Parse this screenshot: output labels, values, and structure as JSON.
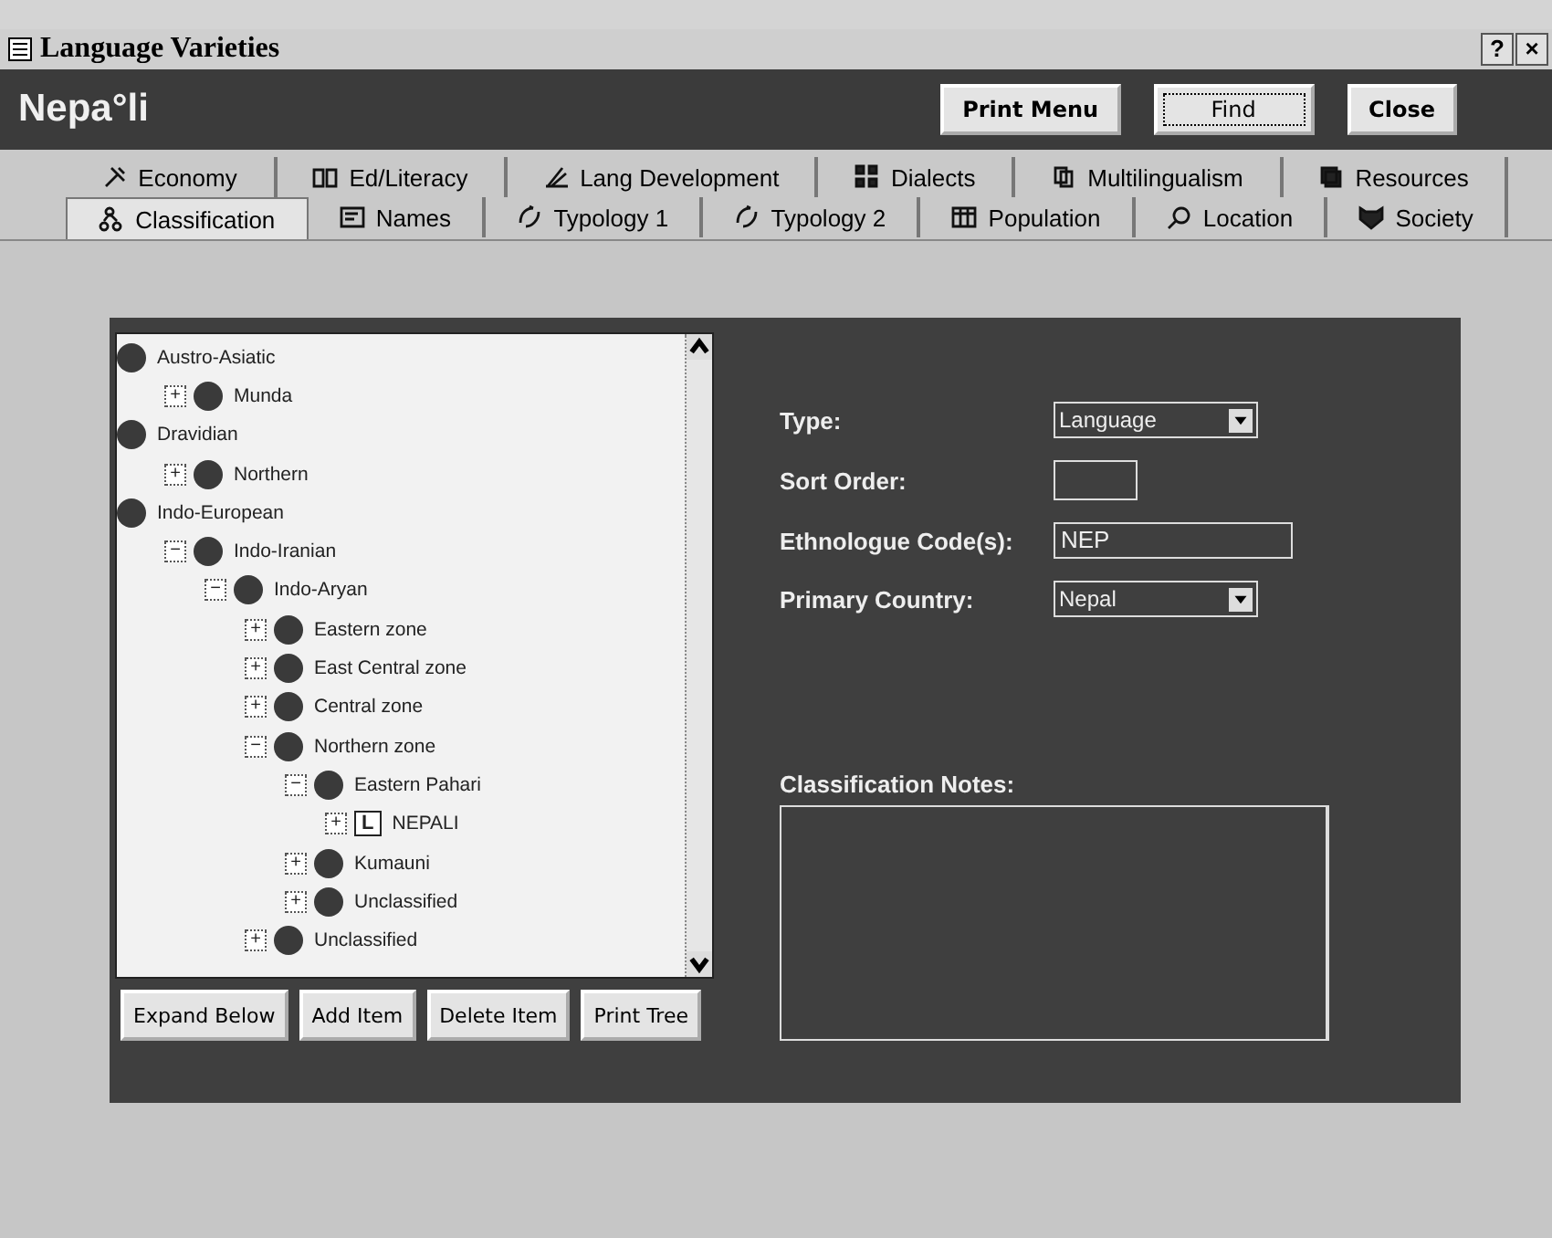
{
  "window": {
    "title": "Language Varieties",
    "help": "?",
    "close": "×"
  },
  "header": {
    "name": "Nepa°li",
    "buttons": [
      {
        "label": "Print Menu",
        "focused": false
      },
      {
        "label": "Find",
        "focused": true
      },
      {
        "label": "Close",
        "focused": false
      }
    ]
  },
  "tab_rows": [
    [
      {
        "label": "Economy",
        "selected": false
      },
      {
        "label": "Ed/Literacy",
        "selected": false
      },
      {
        "label": "Lang Development",
        "selected": false
      },
      {
        "label": "Dialects",
        "selected": false
      },
      {
        "label": "Multilingualism",
        "selected": false
      },
      {
        "label": "Resources",
        "selected": false
      }
    ],
    [
      {
        "label": "Classification",
        "selected": true
      },
      {
        "label": "Names",
        "selected": false
      },
      {
        "label": "Typology 1",
        "selected": false
      },
      {
        "label": "Typology 2",
        "selected": false
      },
      {
        "label": "Population",
        "selected": false
      },
      {
        "label": "Location",
        "selected": false
      },
      {
        "label": "Society",
        "selected": false
      }
    ]
  ],
  "tree": [
    {
      "label": "Austro-Asiatic",
      "kind": "family",
      "children": [
        {
          "label": "Munda",
          "kind": "family",
          "toggle": "+"
        }
      ]
    },
    {
      "label": "Dravidian",
      "kind": "family",
      "children": [
        {
          "label": "Northern",
          "kind": "family",
          "toggle": "+"
        }
      ]
    },
    {
      "label": "Indo-European",
      "kind": "family",
      "children": [
        {
          "label": "Indo-Iranian",
          "kind": "family",
          "toggle": "−",
          "children": [
            {
              "label": "Indo-Aryan",
              "kind": "family",
              "toggle": "−",
              "children": [
                {
                  "label": "Eastern zone",
                  "kind": "family",
                  "toggle": "+"
                },
                {
                  "label": "East Central zone",
                  "kind": "family",
                  "toggle": "+"
                },
                {
                  "label": "Central zone",
                  "kind": "family",
                  "toggle": "+"
                },
                {
                  "label": "Northern zone",
                  "kind": "family",
                  "toggle": "−",
                  "children": [
                    {
                      "label": "Eastern Pahari",
                      "kind": "family",
                      "toggle": "−",
                      "children": [
                        {
                          "label": "NEPALI",
                          "kind": "language",
                          "badge": "L",
                          "toggle": "+"
                        }
                      ]
                    },
                    {
                      "label": "Kumauni",
                      "kind": "family",
                      "toggle": "+"
                    },
                    {
                      "label": "Unclassified",
                      "kind": "family",
                      "toggle": "+"
                    }
                  ]
                },
                {
                  "label": "Unclassified",
                  "kind": "family",
                  "toggle": "+"
                }
              ]
            }
          ]
        }
      ]
    }
  ],
  "tree_buttons": [
    "Expand Below",
    "Add Item",
    "Delete Item",
    "Print Tree"
  ],
  "fields": [
    {
      "label": "Type:",
      "kind": "dropdown",
      "value": "Language"
    },
    {
      "label": "Sort Order:",
      "kind": "short"
    },
    {
      "label": "Ethnologue Code(s):",
      "kind": "text",
      "value": "NEP"
    },
    {
      "label": "Primary Country:",
      "kind": "dropdown",
      "value": "Nepal"
    }
  ],
  "notes": {
    "label": "Classification Notes:"
  }
}
